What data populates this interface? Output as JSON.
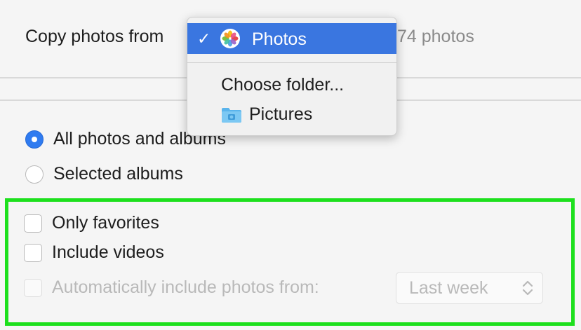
{
  "header": {
    "copy_label": "Copy photos from",
    "photo_count": "74 photos"
  },
  "dropdown": {
    "items": [
      {
        "label": "Photos",
        "selected": true,
        "icon": "photos-app-icon"
      },
      {
        "label": "Choose folder..."
      },
      {
        "label": "Pictures",
        "icon": "folder-icon"
      }
    ]
  },
  "options": {
    "radio_all": "All photos and albums",
    "radio_selected": "Selected albums",
    "only_favorites": "Only favorites",
    "include_videos": "Include videos",
    "auto_include": "Automatically include photos from:",
    "period_value": "Last week"
  },
  "colors": {
    "highlight": "#1de01d",
    "accent": "#3a76e0"
  }
}
